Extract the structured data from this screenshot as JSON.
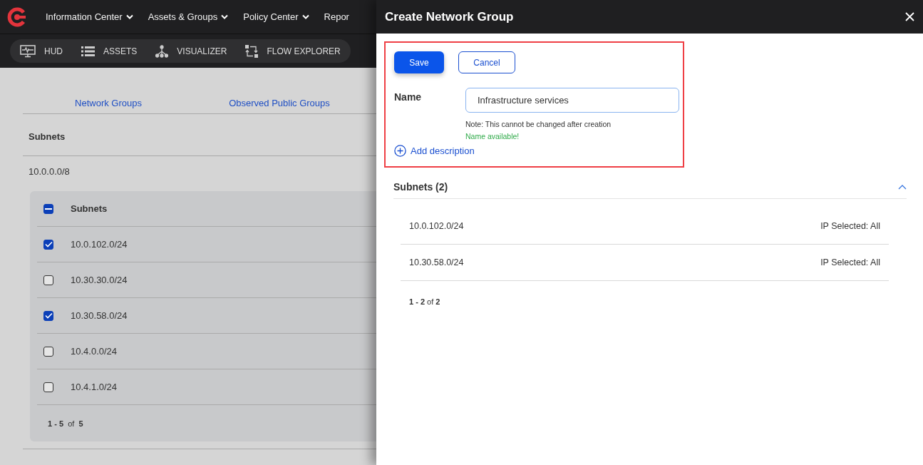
{
  "top_nav": {
    "items": [
      {
        "label": "Information Center",
        "dropdown": true
      },
      {
        "label": "Assets & Groups",
        "dropdown": true
      },
      {
        "label": "Policy Center",
        "dropdown": true
      },
      {
        "label": "Repor",
        "dropdown": false
      }
    ]
  },
  "sub_nav": {
    "items": [
      {
        "kind": "monitor",
        "label": "HUD"
      },
      {
        "kind": "list",
        "label": "ASSETS"
      },
      {
        "kind": "tree",
        "label": "VISUALIZER"
      },
      {
        "kind": "flow",
        "label": "FLOW EXPLORER"
      }
    ]
  },
  "tabs": [
    {
      "label": "Network Groups",
      "selected": false
    },
    {
      "label": "Observed Public Groups",
      "selected": false
    }
  ],
  "section_title": "Subnets",
  "parent_subnet": "10.0.0.0/8",
  "subnet_table": {
    "header": {
      "label": "Subnets",
      "indeterminate": true
    },
    "rows": [
      {
        "subnet": "10.0.102.0/24",
        "checked": true
      },
      {
        "subnet": "10.30.30.0/24",
        "checked": false
      },
      {
        "subnet": "10.30.58.0/24",
        "checked": true
      },
      {
        "subnet": "10.4.0.0/24",
        "checked": false
      },
      {
        "subnet": "10.4.1.0/24",
        "checked": false
      }
    ],
    "pagination": "**1 - 5**  of  **5**"
  },
  "drawer": {
    "title": "Create Network Group",
    "buttons": [
      {
        "kind": "primary",
        "label": "Save"
      },
      {
        "kind": "secondary",
        "label": "Cancel"
      }
    ],
    "name_field": {
      "label": "Name",
      "value": "Infrastructure services",
      "note": "Note: This cannot be changed after creation",
      "status": "Name available!"
    },
    "add_description": "Add description",
    "subnets": {
      "title": "Subnets (2)",
      "expanded": true,
      "rows": [
        {
          "subnet": "10.0.102.0/24",
          "ip_selected": "IP Selected: All"
        },
        {
          "subnet": "10.30.58.0/24",
          "ip_selected": "IP Selected: All"
        }
      ],
      "pagination": "**1 - 2** of **2**"
    }
  }
}
